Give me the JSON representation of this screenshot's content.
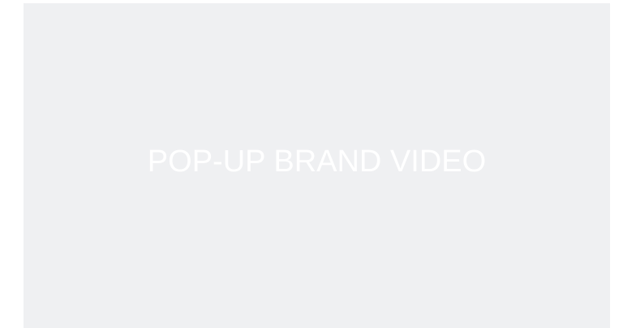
{
  "video_placeholder": {
    "title": "POP-UP BRAND VIDEO",
    "background_color": "#eff0f2",
    "text_color": "#ffffff"
  }
}
